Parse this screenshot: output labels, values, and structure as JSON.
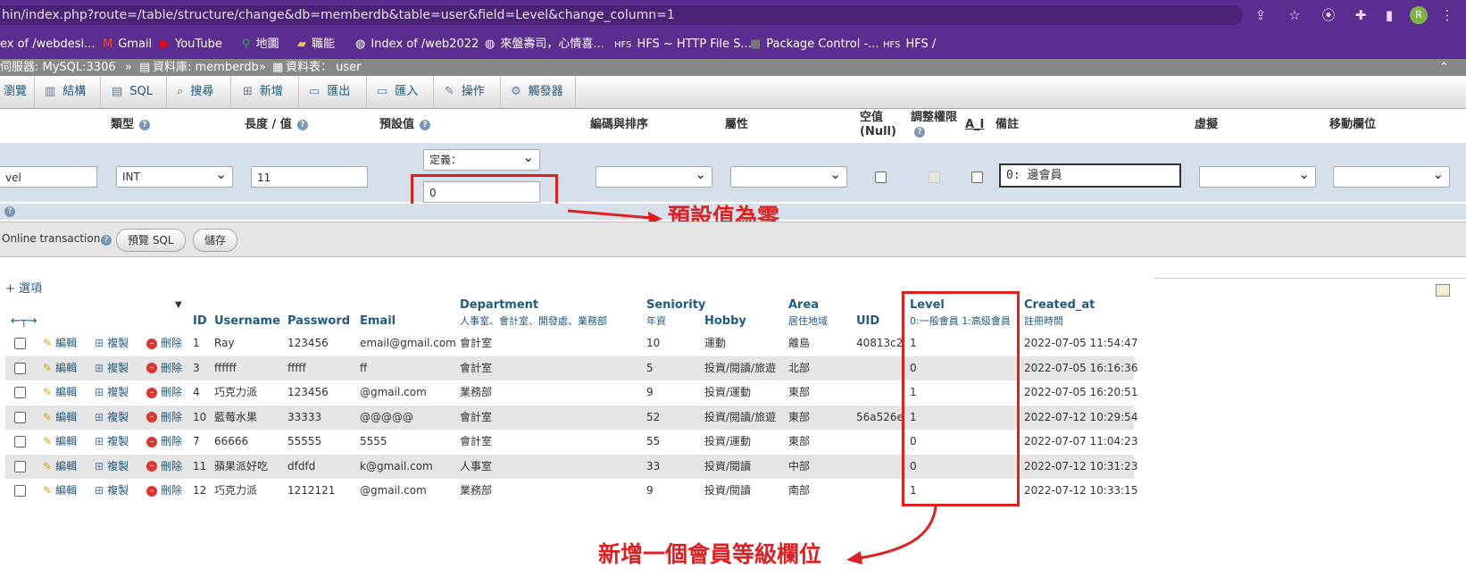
{
  "browser": {
    "url": "hin/index.php?route=/table/structure/change&db=memberdb&table=user&field=Level&change_column=1",
    "avatar": "R",
    "bookmarks": [
      "ex of /webdesi...",
      "Gmail",
      "YouTube",
      "地圖",
      "職能",
      "Index of /web2022",
      "來盤壽司，心情喜...",
      "HFS ~ HTTP File S...",
      "Package Control -...",
      "HFS /"
    ]
  },
  "breadcrumb": {
    "server": "伺服器: MySQL:3306",
    "db": "資料庫: memberdb",
    "table": "資料表： user"
  },
  "tabs": [
    "瀏覽",
    "結構",
    "SQL",
    "搜尋",
    "新增",
    "匯出",
    "匯入",
    "操作",
    "觸發器"
  ],
  "headers": {
    "type": "類型",
    "length": "長度 / 值",
    "default": "預設值",
    "collation": "編碼與排序",
    "attributes": "屬性",
    "null1": "空值",
    "null2": "(Null)",
    "privileges": "調整權限",
    "ai": "A_I",
    "comment": "備註",
    "virtual": "虛擬",
    "move": "移動欄位"
  },
  "editor": {
    "name": "vel",
    "type": "INT",
    "length": "11",
    "default_type": "定義：",
    "default_value": "0",
    "comment": "0: 邊會員"
  },
  "actions": {
    "online_transaction": "Online transaction",
    "preview": "預覽 SQL",
    "save": "儲存"
  },
  "options_link": "+ 選項",
  "table": {
    "columns": {
      "id": "ID",
      "username": "Username",
      "password": "Password",
      "email": "Email",
      "department": "Department",
      "department_sub": "人事室、會計室、開發處、業務部",
      "seniority": "Seniority",
      "seniority_sub": "年資",
      "hobby": "Hobby",
      "area": "Area",
      "area_sub": "居住地域",
      "uid": "UID",
      "level": "Level",
      "level_sub": "0:一般會員 1:高級會員",
      "created": "Created_at",
      "created_sub": "註冊時間"
    },
    "row_actions": {
      "edit": "編輯",
      "copy": "複製",
      "delete": "刪除"
    },
    "rows": [
      {
        "id": "1",
        "username": "Ray",
        "password": "123456",
        "email": "email@gmail.com",
        "department": " 會計室",
        "seniority": "10",
        "hobby": "運動",
        "area": "離島",
        "uid": "40813c2",
        "level": "1",
        "created": "2022-07-05 11:54:47"
      },
      {
        "id": "3",
        "username": "ffffff",
        "password": "fffff",
        "email": "ff",
        "department": "會計室",
        "seniority": "5",
        "hobby": "投資/閱讀/旅遊",
        "area": "北部",
        "uid": "",
        "level": "0",
        "created": "2022-07-05 16:16:36"
      },
      {
        "id": "4",
        "username": "巧克力派",
        "password": "123456",
        "email": "@gmail.com",
        "department": "業務部",
        "seniority": "9",
        "hobby": "投資/運動",
        "area": "東部",
        "uid": "",
        "level": "1",
        "created": "2022-07-05 16:20:51"
      },
      {
        "id": "10",
        "username": "藍莓水果",
        "password": "33333",
        "email": "@@@@@",
        "department": " 會計室",
        "seniority": "52",
        "hobby": "投資/閱讀/旅遊",
        "area": "東部",
        "uid": "56a526e",
        "level": "1",
        "created": "2022-07-12 10:29:54"
      },
      {
        "id": "7",
        "username": "66666",
        "password": "55555",
        "email": "5555",
        "department": " 會計室",
        "seniority": "55",
        "hobby": "投資/運動",
        "area": "東部",
        "uid": "",
        "level": "0",
        "created": "2022-07-07 11:04:23"
      },
      {
        "id": "11",
        "username": "蘋果派好吃",
        "password": "dfdfd",
        "email": "k@gmail.com",
        "department": "人事室",
        "seniority": "33",
        "hobby": "投資/閱讀",
        "area": "中部",
        "uid": "",
        "level": "0",
        "created": "2022-07-12 10:31:23"
      },
      {
        "id": "12",
        "username": "巧克力派",
        "password": "1212121",
        "email": "@gmail.com",
        "department": "業務部",
        "seniority": "9",
        "hobby": "投資/閱讀",
        "area": "南部",
        "uid": "",
        "level": "1",
        "created": "2022-07-12 10:33:15"
      }
    ]
  },
  "annotations": {
    "default_zero": "預設值為零",
    "new_level": "新增一個會員等級欄位"
  },
  "colors": {
    "accent_red": "#e02020",
    "chrome_purple": "#5c2d91",
    "link_blue": "#235a81"
  }
}
